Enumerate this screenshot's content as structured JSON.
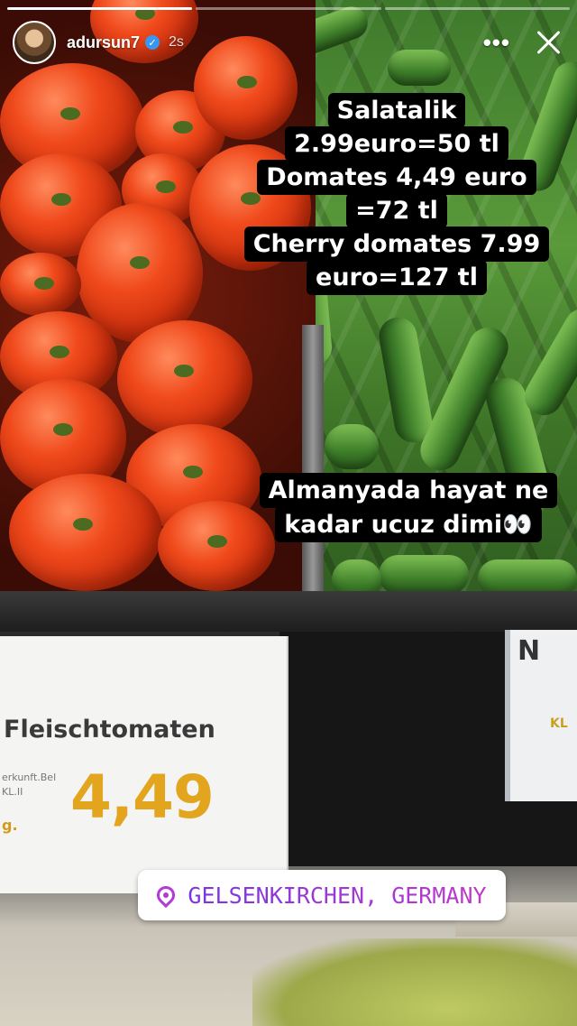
{
  "story": {
    "username": "adursun7",
    "time_ago": "2s",
    "progress_segments": 3,
    "progress_completed": 1
  },
  "icons": {
    "more": "more-horizontal-icon",
    "close": "close-icon",
    "verified": "verified-badge-icon",
    "location": "location-pin-icon"
  },
  "caption_top": {
    "lines": [
      "Salatalik",
      "2.99euro=50 tl",
      "Domates 4,49 euro",
      "=72 tl",
      "Cherry domates 7.99",
      "euro=127 tl"
    ]
  },
  "caption_bottom": {
    "lines": [
      "Almanyada hayat ne",
      "kadar ucuz dimi👀"
    ]
  },
  "price_sign": {
    "product": "Fleischtomaten",
    "origin_text": "erkunft.Bel",
    "class_text": "KL.II",
    "unit_text": "g.",
    "price": "4,49"
  },
  "side_sign": {
    "letter": "N",
    "class_text": "KL"
  },
  "location_sticker": {
    "text": "GELSENKIRCHEN, GERMANY"
  },
  "colors": {
    "location_text": "#8a2bd6",
    "verified": "#3897f0",
    "price": "#e3a51e"
  }
}
